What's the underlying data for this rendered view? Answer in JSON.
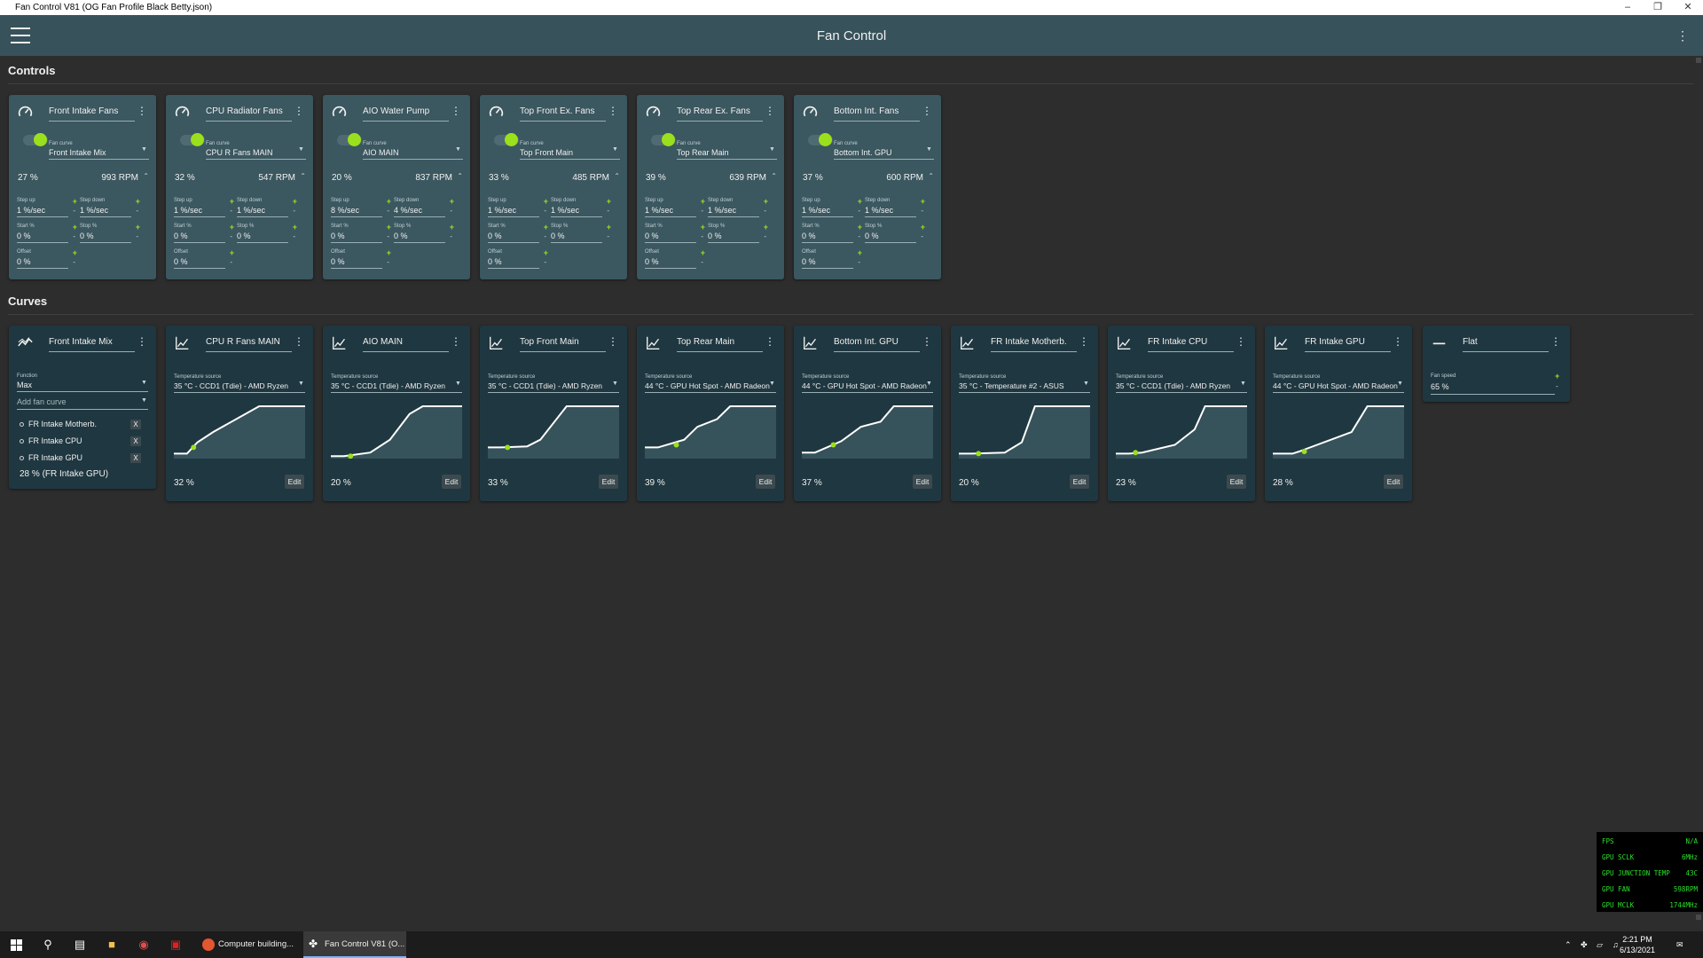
{
  "window": {
    "title": "Fan Control V81 (OG Fan Profile Black Betty.json)",
    "minimize": "–",
    "maximize": "❐",
    "close": "✕"
  },
  "app": {
    "title": "Fan Control",
    "menu_icon": "hamburger-icon",
    "more_icon": "kebab-icon"
  },
  "sections": {
    "controls": "Controls",
    "curves": "Curves"
  },
  "colors": {
    "accent": "#9be01c",
    "header": "#37525b",
    "control_card": "#3b5760",
    "curve_card": "#1f3740",
    "background": "#2d2d2d"
  },
  "controls": [
    {
      "name": "Front Intake Fans",
      "fan_curve_label": "Fan curve",
      "fan_curve": "Front Intake Mix",
      "percent": "27 %",
      "rpm": "993 RPM",
      "step_up_label": "Step up",
      "step_up": "1 %/sec",
      "step_down_label": "Step down",
      "step_down": "1 %/sec",
      "start_label": "Start %",
      "start": "0 %",
      "stop_label": "Stop %",
      "stop": "0 %",
      "offset_label": "Offset",
      "offset": "0 %"
    },
    {
      "name": "CPU Radiator Fans",
      "fan_curve_label": "Fan curve",
      "fan_curve": "CPU R Fans MAIN",
      "percent": "32 %",
      "rpm": "547 RPM",
      "step_up_label": "Step up",
      "step_up": "1 %/sec",
      "step_down_label": "Step down",
      "step_down": "1 %/sec",
      "start_label": "Start %",
      "start": "0 %",
      "stop_label": "Stop %",
      "stop": "0 %",
      "offset_label": "Offset",
      "offset": "0 %"
    },
    {
      "name": "AIO Water Pump",
      "fan_curve_label": "Fan curve",
      "fan_curve": "AIO MAIN",
      "percent": "20 %",
      "rpm": "837 RPM",
      "step_up_label": "Step up",
      "step_up": "8 %/sec",
      "step_down_label": "Step down",
      "step_down": "4 %/sec",
      "start_label": "Start %",
      "start": "0 %",
      "stop_label": "Stop %",
      "stop": "0 %",
      "offset_label": "Offset",
      "offset": "0 %"
    },
    {
      "name": "Top Front Ex. Fans",
      "fan_curve_label": "Fan curve",
      "fan_curve": "Top Front Main",
      "percent": "33 %",
      "rpm": "485 RPM",
      "step_up_label": "Step up",
      "step_up": "1 %/sec",
      "step_down_label": "Step down",
      "step_down": "1 %/sec",
      "start_label": "Start %",
      "start": "0 %",
      "stop_label": "Stop %",
      "stop": "0 %",
      "offset_label": "Offset",
      "offset": "0 %"
    },
    {
      "name": "Top Rear Ex. Fans",
      "fan_curve_label": "Fan curve",
      "fan_curve": "Top Rear Main",
      "percent": "39 %",
      "rpm": "639 RPM",
      "step_up_label": "Step up",
      "step_up": "1 %/sec",
      "step_down_label": "Step down",
      "step_down": "1 %/sec",
      "start_label": "Start %",
      "start": "0 %",
      "stop_label": "Stop %",
      "stop": "0 %",
      "offset_label": "Offset",
      "offset": "0 %"
    },
    {
      "name": "Bottom Int. Fans",
      "fan_curve_label": "Fan curve",
      "fan_curve": "Bottom Int. GPU",
      "percent": "37 %",
      "rpm": "600 RPM",
      "step_up_label": "Step up",
      "step_up": "1 %/sec",
      "step_down_label": "Step down",
      "step_down": "1 %/sec",
      "start_label": "Start %",
      "start": "0 %",
      "stop_label": "Stop %",
      "stop": "0 %",
      "offset_label": "Offset",
      "offset": "0 %"
    }
  ],
  "mix_curve": {
    "name": "Front Intake Mix",
    "function_label": "Function",
    "function": "Max",
    "add_placeholder": "Add fan curve",
    "items": [
      "FR Intake Motherb.",
      "FR Intake CPU",
      "FR Intake GPU"
    ],
    "remove_label": "X",
    "result": "28 % (FR Intake GPU)"
  },
  "curves": [
    {
      "name": "CPU R Fans MAIN",
      "source_label": "Temperature source",
      "source": "35 °C - CCD1 (Tdie) - AMD Ryzen",
      "percent": "32 %",
      "edit": "Edit",
      "points": [
        [
          0,
          0.08
        ],
        [
          0.1,
          0.08
        ],
        [
          0.18,
          0.3
        ],
        [
          0.3,
          0.5
        ],
        [
          0.65,
          1
        ],
        [
          1,
          1
        ]
      ],
      "dot": [
        0.15,
        0.2
      ]
    },
    {
      "name": "AIO MAIN",
      "source_label": "Temperature source",
      "source": "35 °C - CCD1 (Tdie) - AMD Ryzen",
      "percent": "20 %",
      "edit": "Edit",
      "points": [
        [
          0,
          0.03
        ],
        [
          0.1,
          0.03
        ],
        [
          0.3,
          0.1
        ],
        [
          0.45,
          0.35
        ],
        [
          0.6,
          0.85
        ],
        [
          0.7,
          1
        ],
        [
          1,
          1
        ]
      ],
      "dot": [
        0.15,
        0.03
      ]
    },
    {
      "name": "Top Front Main",
      "source_label": "Temperature source",
      "source": "35 °C - CCD1 (Tdie) - AMD Ryzen",
      "percent": "33 %",
      "edit": "Edit",
      "points": [
        [
          0,
          0.2
        ],
        [
          0.1,
          0.2
        ],
        [
          0.3,
          0.22
        ],
        [
          0.4,
          0.35
        ],
        [
          0.6,
          1
        ],
        [
          1,
          1
        ]
      ],
      "dot": [
        0.15,
        0.2
      ]
    },
    {
      "name": "Top Rear Main",
      "source_label": "Temperature source",
      "source": "44 °C - GPU Hot Spot - AMD Radeon",
      "percent": "39 %",
      "edit": "Edit",
      "points": [
        [
          0,
          0.2
        ],
        [
          0.1,
          0.2
        ],
        [
          0.3,
          0.35
        ],
        [
          0.4,
          0.6
        ],
        [
          0.55,
          0.75
        ],
        [
          0.65,
          1
        ],
        [
          1,
          1
        ]
      ],
      "dot": [
        0.24,
        0.25
      ]
    },
    {
      "name": "Bottom Int. GPU",
      "source_label": "Temperature source",
      "source": "44 °C - GPU Hot Spot - AMD Radeon",
      "percent": "37 %",
      "edit": "Edit",
      "points": [
        [
          0,
          0.1
        ],
        [
          0.1,
          0.1
        ],
        [
          0.3,
          0.32
        ],
        [
          0.45,
          0.6
        ],
        [
          0.6,
          0.7
        ],
        [
          0.7,
          1
        ],
        [
          1,
          1
        ]
      ],
      "dot": [
        0.24,
        0.25
      ]
    },
    {
      "name": "FR Intake Motherb.",
      "source_label": "Temperature source",
      "source": "35 °C - Temperature #2 - ASUS",
      "percent": "20 %",
      "edit": "Edit",
      "points": [
        [
          0,
          0.08
        ],
        [
          0.1,
          0.08
        ],
        [
          0.35,
          0.1
        ],
        [
          0.48,
          0.3
        ],
        [
          0.58,
          1
        ],
        [
          1,
          1
        ]
      ],
      "dot": [
        0.15,
        0.08
      ]
    },
    {
      "name": "FR Intake CPU",
      "source_label": "Temperature source",
      "source": "35 °C - CCD1 (Tdie) - AMD Ryzen",
      "percent": "23 %",
      "edit": "Edit",
      "points": [
        [
          0,
          0.08
        ],
        [
          0.1,
          0.08
        ],
        [
          0.2,
          0.1
        ],
        [
          0.45,
          0.25
        ],
        [
          0.6,
          0.55
        ],
        [
          0.68,
          1
        ],
        [
          1,
          1
        ]
      ],
      "dot": [
        0.15,
        0.1
      ]
    },
    {
      "name": "FR Intake GPU",
      "source_label": "Temperature source",
      "source": "44 °C - GPU Hot Spot - AMD Radeon",
      "percent": "28 %",
      "edit": "Edit",
      "points": [
        [
          0,
          0.08
        ],
        [
          0.15,
          0.08
        ],
        [
          0.2,
          0.12
        ],
        [
          0.6,
          0.5
        ],
        [
          0.72,
          1
        ],
        [
          1,
          1
        ]
      ],
      "dot": [
        0.24,
        0.12
      ]
    }
  ],
  "flat_curve": {
    "name": "Flat",
    "speed_label": "Fan speed",
    "speed": "65 %"
  },
  "osd": [
    {
      "key": "FPS",
      "value": "N/A"
    },
    {
      "key": "GPU SCLK",
      "value": "6MHz"
    },
    {
      "key": "GPU JUNCTION TEMP",
      "value": "43C"
    },
    {
      "key": "GPU FAN",
      "value": "598RPM"
    },
    {
      "key": "GPU MCLK",
      "value": "1744MHz"
    }
  ],
  "taskbar": {
    "apps": [
      {
        "label": "Computer building...",
        "icon": "browser-icon",
        "color": "#e2572f"
      },
      {
        "label": "Fan Control V81 (O...",
        "icon": "fan-icon",
        "color": "#ffffff"
      }
    ],
    "time": "2:21 PM",
    "date": "6/13/2021"
  }
}
